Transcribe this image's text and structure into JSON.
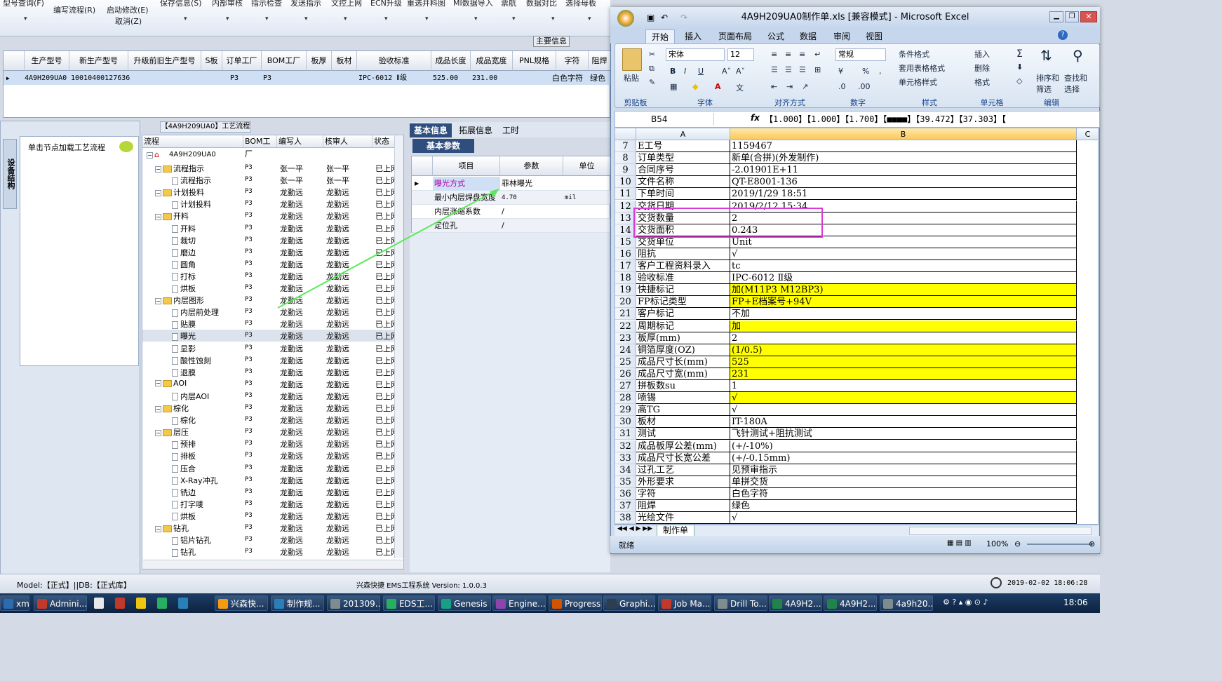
{
  "ems": {
    "toolbar": {
      "top_items": [
        "型号查询(F)",
        "保存信息(S)",
        "内部审核",
        "指示检查",
        "发送指示",
        "文控上网",
        "ECN升级",
        "重选并料图",
        "MI数据导入",
        "票航",
        "数据对比",
        "选择母板"
      ],
      "edit_flow": "编写流程(R)",
      "start_edit": "启动修改(E)",
      "cancel": "取消(Z)"
    },
    "main_info_label": "主要信息",
    "grid": {
      "headers": [
        "生产型号",
        "新生产型号",
        "升级前旧生产型号",
        "S板",
        "订单工厂",
        "BOM工厂",
        "板厚",
        "板材",
        "验收标准",
        "成品长度",
        "成品宽度",
        "PNL规格",
        "字符",
        "阻焊"
      ],
      "row": [
        "4A9H209UA0",
        "10010400127636",
        "",
        "",
        "P3",
        "P3",
        "",
        "",
        "IPC-6012 Ⅱ级",
        "525.00",
        "231.00",
        "",
        "白色字符",
        "绿色"
      ]
    },
    "left_panel": {
      "tab_label": "设备结构",
      "hint": "单击节点加载工艺流程"
    },
    "tree": {
      "title": "【4A9H209UA0】工艺流程",
      "headers": [
        "流程",
        "BOM工厂",
        "编写人",
        "核审人",
        "状态"
      ],
      "root": "4A9H209UA0",
      "rows": [
        {
          "level": 1,
          "name": "流程指示",
          "bom": "P3",
          "writer": "张一平",
          "checker": "张一平",
          "status": "已上网"
        },
        {
          "level": 2,
          "name": "流程指示",
          "bom": "P3",
          "writer": "张一平",
          "checker": "张一平",
          "status": "已上网"
        },
        {
          "level": 1,
          "name": "计划投料",
          "bom": "P3",
          "writer": "龙勤远",
          "checker": "龙勤远",
          "status": "已上网"
        },
        {
          "level": 2,
          "name": "计划投料",
          "bom": "P3",
          "writer": "龙勤远",
          "checker": "龙勤远",
          "status": "已上网"
        },
        {
          "level": 1,
          "name": "开料",
          "bom": "P3",
          "writer": "龙勤远",
          "checker": "龙勤远",
          "status": "已上网"
        },
        {
          "level": 2,
          "name": "开料",
          "bom": "P3",
          "writer": "龙勤远",
          "checker": "龙勤远",
          "status": "已上网"
        },
        {
          "level": 2,
          "name": "裁切",
          "bom": "P3",
          "writer": "龙勤远",
          "checker": "龙勤远",
          "status": "已上网"
        },
        {
          "level": 2,
          "name": "磨边",
          "bom": "P3",
          "writer": "龙勤远",
          "checker": "龙勤远",
          "status": "已上网"
        },
        {
          "level": 2,
          "name": "圆角",
          "bom": "P3",
          "writer": "龙勤远",
          "checker": "龙勤远",
          "status": "已上网"
        },
        {
          "level": 2,
          "name": "打标",
          "bom": "P3",
          "writer": "龙勤远",
          "checker": "龙勤远",
          "status": "已上网"
        },
        {
          "level": 2,
          "name": "烘板",
          "bom": "P3",
          "writer": "龙勤远",
          "checker": "龙勤远",
          "status": "已上网"
        },
        {
          "level": 1,
          "name": "内层图形",
          "bom": "P3",
          "writer": "龙勤远",
          "checker": "龙勤远",
          "status": "已上网"
        },
        {
          "level": 2,
          "name": "内层前处理",
          "bom": "P3",
          "writer": "龙勤远",
          "checker": "龙勤远",
          "status": "已上网"
        },
        {
          "level": 2,
          "name": "贴膜",
          "bom": "P3",
          "writer": "龙勤远",
          "checker": "龙勤远",
          "status": "已上网"
        },
        {
          "level": 2,
          "name": "曝光",
          "bom": "P3",
          "writer": "龙勤远",
          "checker": "龙勤远",
          "status": "已上网",
          "selected": true
        },
        {
          "level": 2,
          "name": "显影",
          "bom": "P3",
          "writer": "龙勤远",
          "checker": "龙勤远",
          "status": "已上网"
        },
        {
          "level": 2,
          "name": "酸性蚀刻",
          "bom": "P3",
          "writer": "龙勤远",
          "checker": "龙勤远",
          "status": "已上网"
        },
        {
          "level": 2,
          "name": "退膜",
          "bom": "P3",
          "writer": "龙勤远",
          "checker": "龙勤远",
          "status": "已上网"
        },
        {
          "level": 1,
          "name": "AOI",
          "bom": "P3",
          "writer": "龙勤远",
          "checker": "龙勤远",
          "status": "已上网"
        },
        {
          "level": 2,
          "name": "内层AOI",
          "bom": "P3",
          "writer": "龙勤远",
          "checker": "龙勤远",
          "status": "已上网"
        },
        {
          "level": 1,
          "name": "棕化",
          "bom": "P3",
          "writer": "龙勤远",
          "checker": "龙勤远",
          "status": "已上网"
        },
        {
          "level": 2,
          "name": "棕化",
          "bom": "P3",
          "writer": "龙勤远",
          "checker": "龙勤远",
          "status": "已上网"
        },
        {
          "level": 1,
          "name": "层压",
          "bom": "P3",
          "writer": "龙勤远",
          "checker": "龙勤远",
          "status": "已上网"
        },
        {
          "level": 2,
          "name": "预排",
          "bom": "P3",
          "writer": "龙勤远",
          "checker": "龙勤远",
          "status": "已上网"
        },
        {
          "level": 2,
          "name": "排板",
          "bom": "P3",
          "writer": "龙勤远",
          "checker": "龙勤远",
          "status": "已上网"
        },
        {
          "level": 2,
          "name": "压合",
          "bom": "P3",
          "writer": "龙勤远",
          "checker": "龙勤远",
          "status": "已上网"
        },
        {
          "level": 2,
          "name": "X-Ray冲孔",
          "bom": "P3",
          "writer": "龙勤远",
          "checker": "龙勤远",
          "status": "已上网"
        },
        {
          "level": 2,
          "name": "铣边",
          "bom": "P3",
          "writer": "龙勤远",
          "checker": "龙勤远",
          "status": "已上网"
        },
        {
          "level": 2,
          "name": "打字唛",
          "bom": "P3",
          "writer": "龙勤远",
          "checker": "龙勤远",
          "status": "已上网"
        },
        {
          "level": 2,
          "name": "烘板",
          "bom": "P3",
          "writer": "龙勤远",
          "checker": "龙勤远",
          "status": "已上网"
        },
        {
          "level": 1,
          "name": "钻孔",
          "bom": "P3",
          "writer": "龙勤远",
          "checker": "龙勤远",
          "status": "已上网"
        },
        {
          "level": 2,
          "name": "铝片钻孔",
          "bom": "P3",
          "writer": "龙勤远",
          "checker": "龙勤远",
          "status": "已上网"
        },
        {
          "level": 2,
          "name": "钻孔",
          "bom": "P3",
          "writer": "龙勤远",
          "checker": "龙勤远",
          "status": "已上网"
        }
      ]
    },
    "right_tabs": [
      "基本信息",
      "拓展信息",
      "工时"
    ],
    "basic_params_tab": "基本参数",
    "prop": {
      "headers": [
        "项目",
        "参数",
        "单位"
      ],
      "rows": [
        {
          "item": "曝光方式",
          "value": "菲林曝光",
          "unit": ""
        },
        {
          "item": "最小内层焊盘宽度",
          "value": "4.70",
          "unit": "mil"
        },
        {
          "item": "内层涨缩系数",
          "value": "/",
          "unit": ""
        },
        {
          "item": "定位孔",
          "value": "/",
          "unit": ""
        }
      ]
    },
    "status": {
      "model": "Model:【正式】||DB:【正式库】",
      "system": "兴森快捷  EMS工程系统  Version: 1.0.0.3",
      "datetime": "2019-02-02 18:06:28"
    }
  },
  "excel": {
    "title": "4A9H209UA0制作单.xls [兼容模式] - Microsoft Excel",
    "tabs": [
      "开始",
      "插入",
      "页面布局",
      "公式",
      "数据",
      "审阅",
      "视图"
    ],
    "ribbon": {
      "paste": "粘贴",
      "clipboard": "剪贴板",
      "font_name": "宋体",
      "font_size": "12",
      "font_group": "字体",
      "align_group": "对齐方式",
      "number_format": "常规",
      "number_group": "数字",
      "cond_format": "条件格式",
      "table_format": "套用表格格式",
      "cell_style": "单元格样式",
      "style_group": "样式",
      "insert": "插入",
      "delete": "删除",
      "format": "格式",
      "cells_group": "单元格",
      "sort_filter": "排序和筛选",
      "find_select": "查找和选择",
      "edit_group": "编辑"
    },
    "namebox": "B54",
    "formula": "【1.000】【1.000】【1.700】【■■■■】【39.472】【37.303】【",
    "columns": [
      "A",
      "B",
      "C"
    ],
    "rows": [
      {
        "n": "7",
        "a": "E工号",
        "b": "1159467"
      },
      {
        "n": "8",
        "a": "订单类型",
        "b": "新单(合拼)(外发制作)"
      },
      {
        "n": "9",
        "a": "合同序号",
        "b": "-2.01901E+11"
      },
      {
        "n": "10",
        "a": "文件名称",
        "b": "QT-E8001-136"
      },
      {
        "n": "11",
        "a": "下单时间",
        "b": "2019/1/29 18:51"
      },
      {
        "n": "12",
        "a": "交货日期",
        "b": "2019/2/12 15:34"
      },
      {
        "n": "13",
        "a": "交货数量",
        "b": "2"
      },
      {
        "n": "14",
        "a": "交货面积",
        "b": "0.243"
      },
      {
        "n": "15",
        "a": "交货单位",
        "b": "Unit"
      },
      {
        "n": "16",
        "a": "阻抗",
        "b": "√"
      },
      {
        "n": "17",
        "a": "客户工程资料录入",
        "b": "tc"
      },
      {
        "n": "18",
        "a": "验收标准",
        "b": "IPC-6012 Ⅱ级"
      },
      {
        "n": "19",
        "a": "快捷标记",
        "b": "加(M11P3 M12BP3)",
        "hl": true
      },
      {
        "n": "20",
        "a": "FP标记类型",
        "b": "FP+E档案号+94V",
        "hl": true
      },
      {
        "n": "21",
        "a": "客户标记",
        "b": "不加"
      },
      {
        "n": "22",
        "a": "周期标记",
        "b": "加",
        "hl": true
      },
      {
        "n": "23",
        "a": "板厚(mm)",
        "b": "2"
      },
      {
        "n": "24",
        "a": "铜箔厚度(OZ)",
        "b": "(1/0.5)",
        "hl": true
      },
      {
        "n": "25",
        "a": "成品尺寸长(mm)",
        "b": "525",
        "hl": true
      },
      {
        "n": "26",
        "a": "成品尺寸宽(mm)",
        "b": "231",
        "hl": true
      },
      {
        "n": "27",
        "a": "拼板数su",
        "b": "1"
      },
      {
        "n": "28",
        "a": "喷锡",
        "b": "√",
        "hl": true
      },
      {
        "n": "29",
        "a": "高TG",
        "b": "√"
      },
      {
        "n": "30",
        "a": "板材",
        "b": "IT-180A"
      },
      {
        "n": "31",
        "a": "测试",
        "b": "飞针测试+阻抗测试"
      },
      {
        "n": "32",
        "a": "成品板厚公差(mm)",
        "b": "(+/-10%)"
      },
      {
        "n": "33",
        "a": "成品尺寸长宽公差",
        "b": "(+/-0.15mm)"
      },
      {
        "n": "34",
        "a": "过孔工艺",
        "b": "见预审指示"
      },
      {
        "n": "35",
        "a": "外形要求",
        "b": "单拼交货"
      },
      {
        "n": "36",
        "a": "字符",
        "b": "白色字符"
      },
      {
        "n": "37",
        "a": "阻焊",
        "b": "绿色"
      },
      {
        "n": "38",
        "a": "光绘文件",
        "b": "√"
      }
    ],
    "sheet_tab": "制作单",
    "status_ready": "就绪",
    "zoom": "100%"
  },
  "taskbar": {
    "items": [
      "xmail",
      "Admini...",
      "兴森快...",
      "制作规...",
      "201309...",
      "EDS工...",
      "Genesis",
      "Engine...",
      "Progress",
      "Graphi...",
      "Job Ma...",
      "Drill To...",
      "4A9H2...",
      "4A9H2...",
      "4a9h20..."
    ],
    "time": "18:06"
  },
  "colors": {
    "highlight_yellow": "#ffff00",
    "annotation_magenta": "#d93ad9",
    "arrow_green": "#5ee85e",
    "selected_row": "#cfe0f5"
  }
}
